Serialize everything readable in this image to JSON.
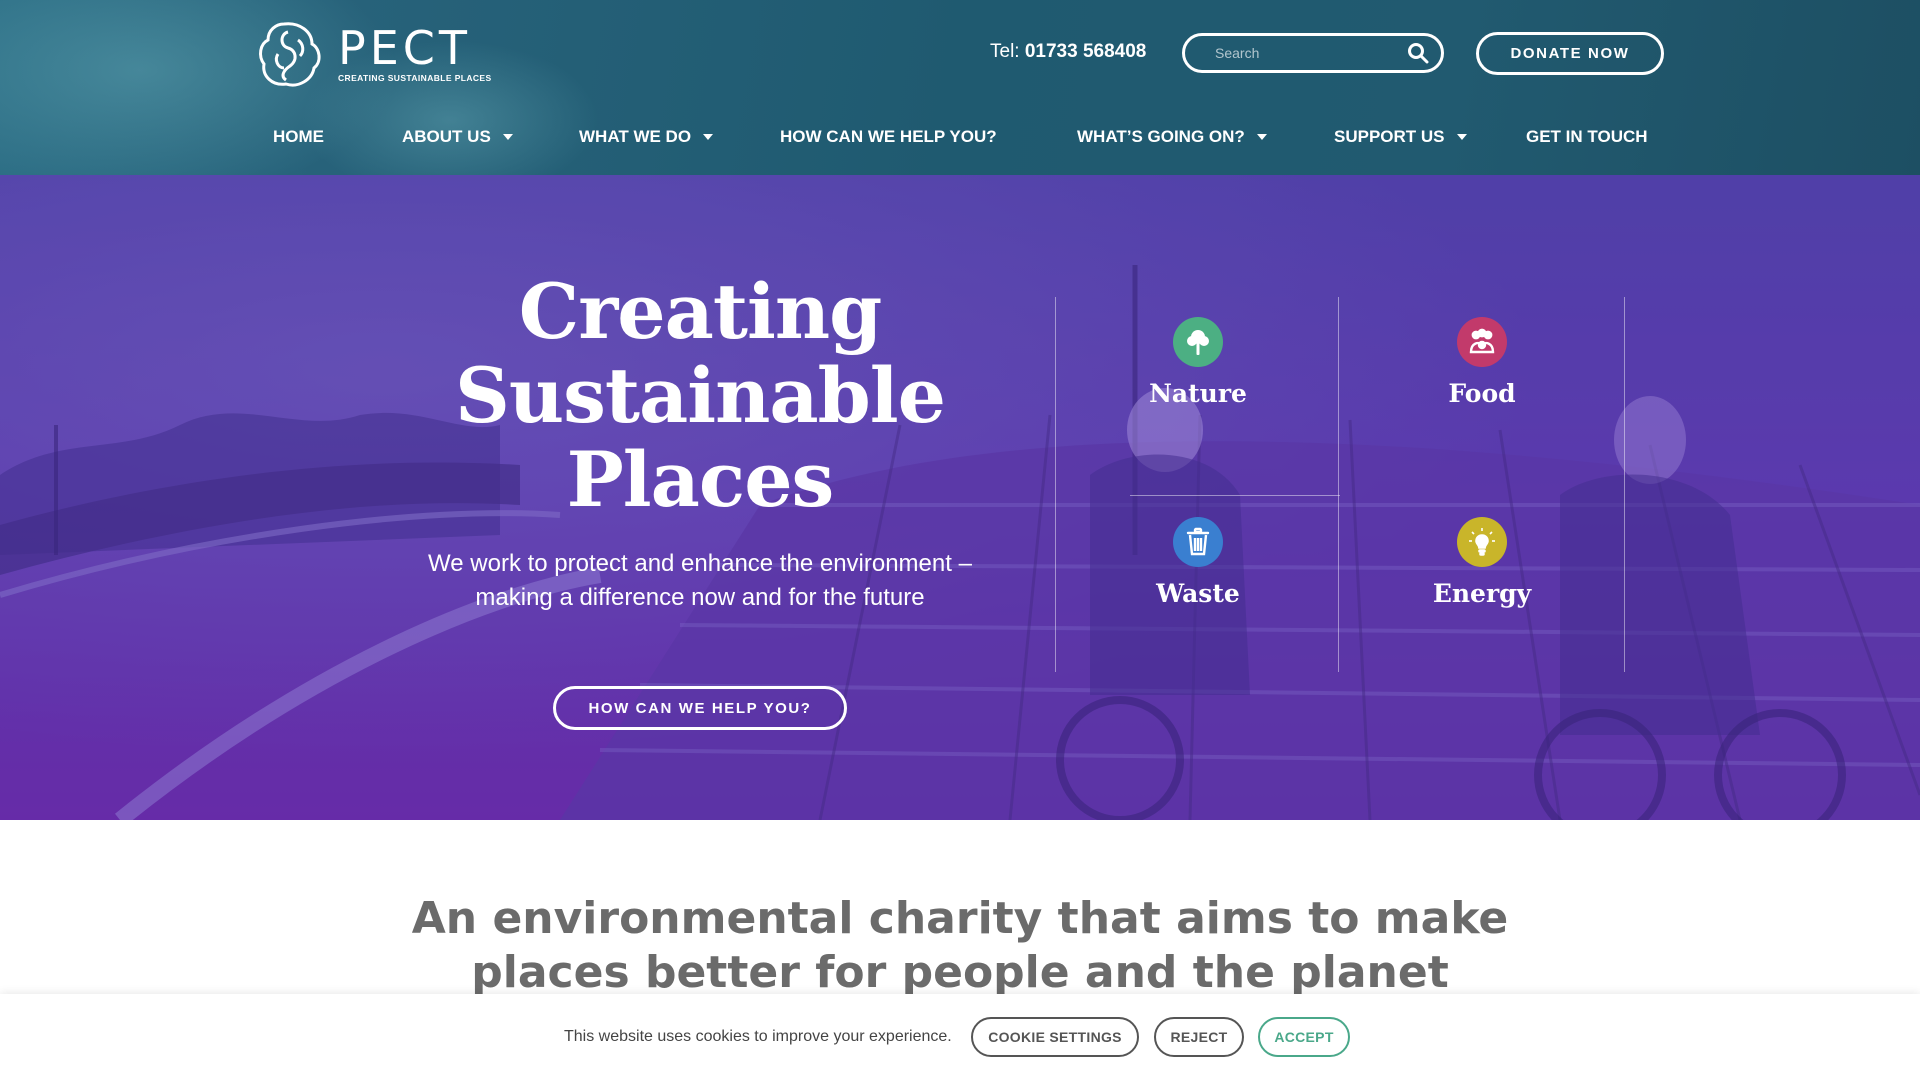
{
  "header": {
    "logo": {
      "name": "PECT",
      "tagline": "CREATING SUSTAINABLE PLACES"
    },
    "tel_label": "Tel:",
    "tel_number": "01733 568408",
    "search_placeholder": "Search",
    "donate_label": "DONATE NOW"
  },
  "nav": {
    "items": [
      {
        "label": "HOME",
        "has_dropdown": false
      },
      {
        "label": "ABOUT US",
        "has_dropdown": true
      },
      {
        "label": "WHAT WE DO",
        "has_dropdown": true
      },
      {
        "label": "HOW CAN WE HELP YOU?",
        "has_dropdown": false
      },
      {
        "label": "WHAT’S GOING ON?",
        "has_dropdown": true
      },
      {
        "label": "SUPPORT US",
        "has_dropdown": true
      },
      {
        "label": "GET IN TOUCH",
        "has_dropdown": false
      }
    ]
  },
  "hero": {
    "title_line1": "Creating",
    "title_line2": "Sustainable",
    "title_line3": "Places",
    "subtitle": "We work to protect and enhance the environment – making a difference now and for the future",
    "cta_label": "HOW CAN WE HELP YOU?",
    "tiles": [
      {
        "label": "Nature",
        "icon": "tree-icon",
        "color": "#4caf83"
      },
      {
        "label": "Food",
        "icon": "people-group-icon",
        "color": "#c23a6b"
      },
      {
        "label": "Waste",
        "icon": "bin-icon",
        "color": "#3a7fd0"
      },
      {
        "label": "Energy",
        "icon": "lightbulb-icon",
        "color": "#c9b52a"
      }
    ]
  },
  "main": {
    "headline_line1": "An environmental charity that aims to make",
    "headline_line2": "places better for people and the planet"
  },
  "cookie_bar": {
    "text": "This website uses cookies to improve your experience.",
    "settings_label": "COOKIE SETTINGS",
    "reject_label": "REJECT",
    "accept_label": "ACCEPT",
    "accept_color": "#4aa88a",
    "neutral_color": "#555555"
  }
}
